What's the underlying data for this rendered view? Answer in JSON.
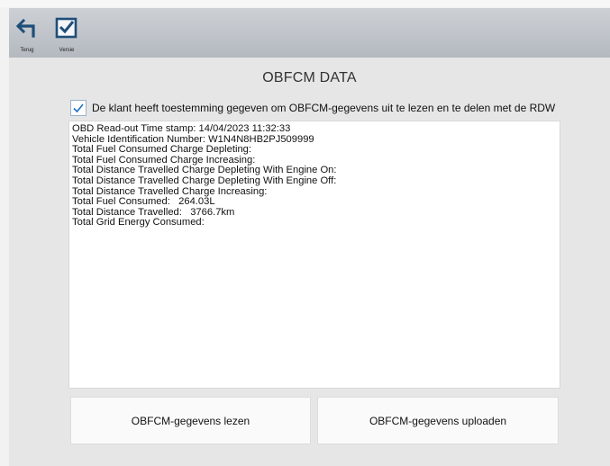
{
  "toolbar": {
    "back_label": "Terug",
    "version_label": "Versie",
    "back_icon": "back-arrow-icon",
    "version_icon": "checkbox-check-icon"
  },
  "page": {
    "title": "OBFCM DATA"
  },
  "consent": {
    "checked": true,
    "label": "De klant heeft toestemming gegeven om OBFCM-gegevens uit te lezen en te delen met de RDW"
  },
  "readout": {
    "lines": [
      "OBD Read-out Time stamp: 14/04/2023 11:32:33",
      "Vehicle Identification Number: W1N4N8HB2PJ509999",
      "Total Fuel Consumed Charge Depleting:",
      "Total Fuel Consumed Charge Increasing:",
      "Total Distance Travelled Charge Depleting With Engine On:",
      "Total Distance Travelled Charge Depleting With Engine Off:",
      "Total Distance Travelled Charge Increasing:",
      "Total Fuel Consumed:   264.03L",
      "Total Distance Travelled:   3766.7km",
      "Total Grid Energy Consumed:"
    ]
  },
  "actions": {
    "read_label": "OBFCM-gegevens lezen",
    "upload_label": "OBFCM-gegevens uploaden"
  },
  "colors": {
    "accent": "#1f4e79",
    "check": "#1a73c9"
  }
}
